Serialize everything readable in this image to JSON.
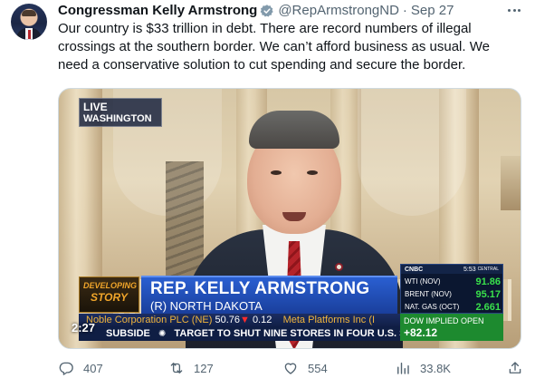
{
  "tweet": {
    "display_name": "Congressman Kelly Armstrong",
    "verified_icon": "verified-badge-icon",
    "handle": "@RepArmstrongND",
    "separator": "·",
    "date": "Sep 27",
    "more_icon": "more-icon",
    "text": "Our country is $33 trillion in debt. There are record numbers of illegal crossings at the southern border. We can’t afford business as usual. We need a conservative solution to cut spending and secure the border."
  },
  "video": {
    "live_line1": "LIVE",
    "live_line2": "WASHINGTON",
    "developing_line1": "DEVELOPING",
    "developing_line2": "STORY",
    "name": "REP. KELLY ARMSTRONG",
    "subtitle": "(R) NORTH DAKOTA",
    "network": "CNBC",
    "time": "5:53",
    "time_zone": "CENTRAL",
    "markets": [
      {
        "label": "WTI (NOV)",
        "value": "91.86"
      },
      {
        "label": "BRENT (NOV)",
        "value": "95.17"
      },
      {
        "label": "NAT. GAS (OCT)",
        "value": "2.661"
      }
    ],
    "ticker_name": "Noble Corporation PLC (NE)",
    "ticker_price": "50.76",
    "ticker_change": "0.12",
    "ticker_next": "Meta Platforms Inc (I",
    "crawl_prefix": "SUBSIDE",
    "crawl_text": "TARGET TO SHUT NINE STORES IN FOUR U.S. S",
    "dow_label": "DOW IMPLIED OPEN",
    "dow_value": "+82.12",
    "duration": "2:27",
    "accent_blue": "#2a5fd1",
    "accent_green": "#1d8a2f",
    "accent_orange": "#f0a52a"
  },
  "actions": {
    "reply_icon": "reply-icon",
    "replies": "407",
    "retweet_icon": "retweet-icon",
    "retweets": "127",
    "like_icon": "like-icon",
    "likes": "554",
    "views_icon": "views-icon",
    "views": "33.8K",
    "share_icon": "share-icon"
  }
}
